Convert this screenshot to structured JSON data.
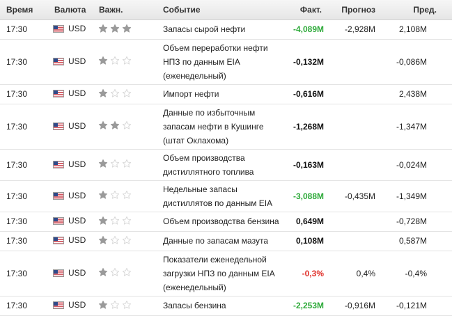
{
  "header": {
    "time": "Время",
    "currency": "Валюта",
    "importance": "Важн.",
    "event": "Событие",
    "actual": "Факт.",
    "forecast": "Прогноз",
    "previous": "Пред."
  },
  "colors": {
    "positive": "#2eaa3a",
    "negative": "#e0302a",
    "neutral": "#111111",
    "star_filled": "#9a9a9a",
    "star_empty": "#d6d6d6"
  },
  "icons": {
    "flag": "us-flag-icon",
    "star_filled": "star-filled-icon",
    "star_empty": "star-empty-icon"
  },
  "rows": [
    {
      "time": "17:30",
      "currency": "USD",
      "importance": 3,
      "event": "Запасы сырой нефти",
      "actual": "-4,089M",
      "actual_tone": "green",
      "forecast": "-2,928M",
      "previous": "2,108M",
      "height": "h1"
    },
    {
      "time": "17:30",
      "currency": "USD",
      "importance": 1,
      "event": "Объем переработки нефти НПЗ по данным EIA (еженедельный)",
      "actual": "-0,132M",
      "actual_tone": "black",
      "forecast": "",
      "previous": "-0,086M",
      "height": "h3"
    },
    {
      "time": "17:30",
      "currency": "USD",
      "importance": 1,
      "event": "Импорт нефти",
      "actual": "-0,616M",
      "actual_tone": "black",
      "forecast": "",
      "previous": "2,438M",
      "height": "h1"
    },
    {
      "time": "17:30",
      "currency": "USD",
      "importance": 2,
      "event": "Данные по избыточным запасам нефти в Кушинге (штат Оклахома)",
      "actual": "-1,268M",
      "actual_tone": "black",
      "forecast": "",
      "previous": "-1,347M",
      "height": "h3"
    },
    {
      "time": "17:30",
      "currency": "USD",
      "importance": 1,
      "event": "Объем производства дистиллятного топлива",
      "actual": "-0,163M",
      "actual_tone": "black",
      "forecast": "",
      "previous": "-0,024M",
      "height": "h2"
    },
    {
      "time": "17:30",
      "currency": "USD",
      "importance": 1,
      "event": "Недельные запасы дистиллятов по данным EIA",
      "actual": "-3,088M",
      "actual_tone": "green",
      "forecast": "-0,435M",
      "previous": "-1,349M",
      "height": "h2"
    },
    {
      "time": "17:30",
      "currency": "USD",
      "importance": 1,
      "event": "Объем производства бензина",
      "actual": "0,649M",
      "actual_tone": "black",
      "forecast": "",
      "previous": "-0,728M",
      "height": "h1"
    },
    {
      "time": "17:30",
      "currency": "USD",
      "importance": 1,
      "event": "Данные по запасам мазута",
      "actual": "0,108M",
      "actual_tone": "black",
      "forecast": "",
      "previous": "0,587M",
      "height": "h1"
    },
    {
      "time": "17:30",
      "currency": "USD",
      "importance": 1,
      "event": "Показатели еженедельной загрузки НПЗ по данным EIA (еженедельный)",
      "actual": "-0,3%",
      "actual_tone": "red",
      "forecast": "0,4%",
      "previous": "-0,4%",
      "height": "h3"
    },
    {
      "time": "17:30",
      "currency": "USD",
      "importance": 1,
      "event": "Запасы бензина",
      "actual": "-2,253M",
      "actual_tone": "green",
      "forecast": "-0,916M",
      "previous": "-0,121M",
      "height": "h1"
    }
  ]
}
